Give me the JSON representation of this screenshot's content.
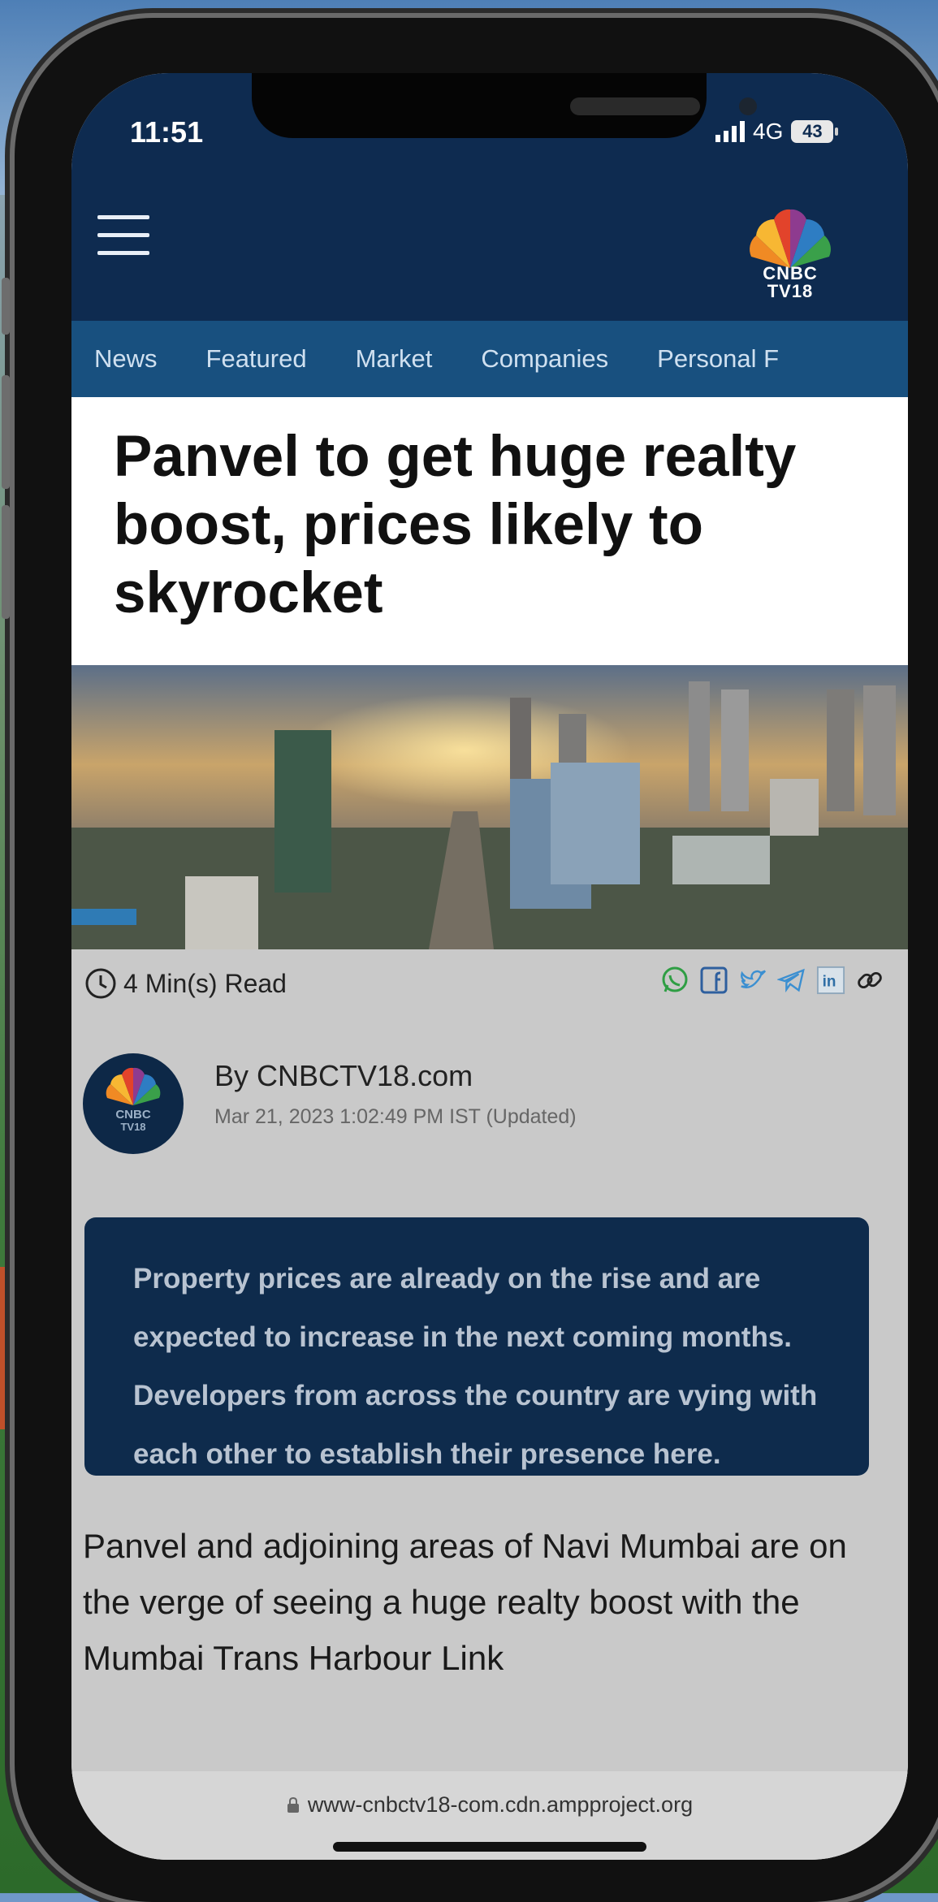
{
  "status": {
    "time": "11:51",
    "network": "4G",
    "battery": "43"
  },
  "header": {
    "logo_line1": "CNBC",
    "logo_line2": "TV18"
  },
  "nav": [
    "News",
    "Featured",
    "Market",
    "Companies",
    "Personal F"
  ],
  "article": {
    "headline": "Panvel to get huge realty boost, prices likely to skyrocket",
    "read_time": "4 Min(s) Read",
    "author": "By CNBCTV18.com",
    "date": "Mar 21, 2023 1:02:49 PM IST (Updated)",
    "summary": "Property prices are already on the rise and are expected to increase in the next coming months. Developers from across the country are vying with each other to establish their presence here.",
    "body": "Panvel and adjoining areas of Navi Mumbai are on the verge of seeing a huge realty boost with the Mumbai Trans Harbour Link"
  },
  "share_icons": [
    "whatsapp-icon",
    "facebook-icon",
    "twitter-icon",
    "telegram-icon",
    "linkedin-icon",
    "link-icon"
  ],
  "browser": {
    "url": "www-cnbctv18-com.cdn.ampproject.org"
  },
  "colors": {
    "header": "#0e2b50",
    "nav": "#18507f",
    "summary_bg": "#0e2b4c"
  }
}
